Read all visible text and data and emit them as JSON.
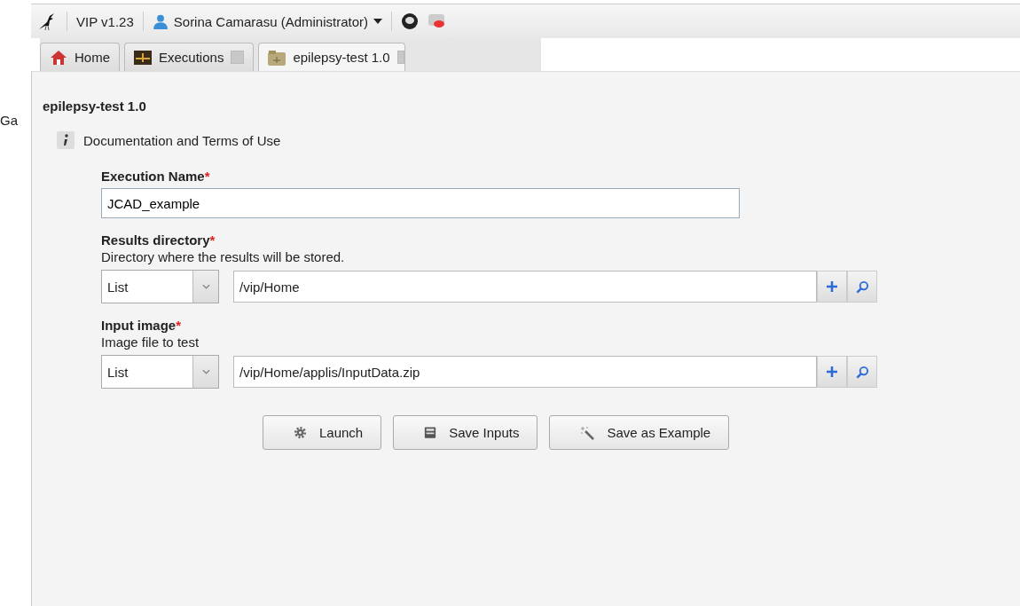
{
  "toolbar": {
    "version": "VIP v1.23",
    "user": "Sorina Camarasu (Administrator)"
  },
  "tabs": [
    {
      "label": "Home",
      "closable": false,
      "selected": false
    },
    {
      "label": "Executions",
      "closable": true,
      "selected": false
    },
    {
      "label": "epilepsy-test 1.0",
      "closable": true,
      "selected": true
    }
  ],
  "background_text": "Ga",
  "panel": {
    "title": "epilepsy-test 1.0",
    "doc_link": "Documentation and Terms of Use",
    "fields": [
      {
        "kind": "text",
        "label": "Execution Name",
        "required_mark": "*",
        "value": "JCAD_example"
      },
      {
        "kind": "path",
        "label": "Results directory",
        "required_mark": "*",
        "description": "Directory where the results will be stored.",
        "mode": "List",
        "value": "/vip/Home"
      },
      {
        "kind": "path",
        "label": "Input image",
        "required_mark": "*",
        "description": "Image file to test",
        "mode": "List",
        "value": "/vip/Home/applis/InputData.zip"
      }
    ],
    "buttons": [
      {
        "label": "Launch"
      },
      {
        "label": "Save Inputs"
      },
      {
        "label": "Save as Example"
      }
    ]
  }
}
